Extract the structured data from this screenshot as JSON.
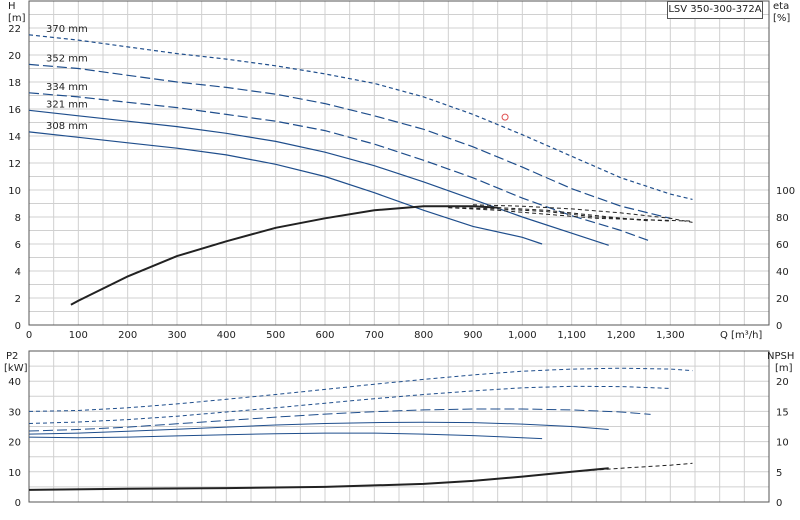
{
  "model_label": "LSV 350-300-372A",
  "colors": {
    "curve": "#1f4e8c",
    "grid": "#d0d0d0",
    "axis": "#555555",
    "marker": "#e05050"
  },
  "chart_data": [
    {
      "type": "line",
      "id": "head-efficiency",
      "xlabel": "Q [m³/h]",
      "xlim": [
        0,
        1500
      ],
      "xticks": [
        0,
        100,
        200,
        300,
        400,
        500,
        600,
        700,
        800,
        900,
        1000,
        1100,
        1200,
        1300
      ],
      "xtick_labels": [
        "0",
        "100",
        "200",
        "300",
        "400",
        "500",
        "600",
        "700",
        "800",
        "900",
        "1,000",
        "1,100",
        "1,200",
        "1,300"
      ],
      "ylabel_left": [
        "H",
        "[m]"
      ],
      "ylim_left": [
        0,
        24
      ],
      "yticks_left": [
        0,
        2,
        4,
        6,
        8,
        10,
        12,
        14,
        16,
        18,
        20,
        22
      ],
      "ylabel_right": [
        "eta",
        "[%]"
      ],
      "ylim_right": [
        0,
        240
      ],
      "yticks_right": [
        0,
        20,
        40,
        60,
        80,
        100
      ],
      "grid": true,
      "head_series": [
        {
          "name": "370 mm",
          "style": "dashed",
          "x": [
            0,
            100,
            200,
            300,
            400,
            500,
            600,
            700,
            800,
            900,
            1000,
            1100,
            1200,
            1300,
            1345
          ],
          "y": [
            21.5,
            21.1,
            20.6,
            20.1,
            19.7,
            19.2,
            18.6,
            17.9,
            16.9,
            15.6,
            14.1,
            12.5,
            10.9,
            9.7,
            9.3
          ]
        },
        {
          "name": "352 mm",
          "style": "mixed",
          "x": [
            0,
            100,
            200,
            300,
            400,
            500,
            600,
            700,
            800,
            900,
            1000,
            1100,
            1200,
            1300
          ],
          "y": [
            19.3,
            19.0,
            18.5,
            18.0,
            17.6,
            17.1,
            16.4,
            15.5,
            14.5,
            13.2,
            11.7,
            10.1,
            8.8,
            7.9
          ]
        },
        {
          "name": "334 mm",
          "style": "mixed",
          "x": [
            0,
            100,
            200,
            300,
            400,
            500,
            600,
            700,
            800,
            900,
            1000,
            1100,
            1200,
            1260
          ],
          "y": [
            17.2,
            16.9,
            16.5,
            16.1,
            15.6,
            15.1,
            14.4,
            13.4,
            12.2,
            10.9,
            9.4,
            8.1,
            7.0,
            6.2
          ]
        },
        {
          "name": "321 mm",
          "style": "solid",
          "x": [
            0,
            100,
            200,
            300,
            400,
            500,
            600,
            700,
            800,
            900,
            1000,
            1100,
            1175
          ],
          "y": [
            15.9,
            15.5,
            15.1,
            14.7,
            14.2,
            13.6,
            12.8,
            11.8,
            10.6,
            9.3,
            8.0,
            6.8,
            5.9
          ]
        },
        {
          "name": "308 mm",
          "style": "solid",
          "x": [
            0,
            100,
            200,
            300,
            400,
            500,
            600,
            700,
            800,
            900,
            1000,
            1040
          ],
          "y": [
            14.3,
            13.9,
            13.5,
            13.1,
            12.6,
            11.9,
            11.0,
            9.8,
            8.5,
            7.3,
            6.5,
            6.0
          ]
        }
      ],
      "efficiency_series": [
        {
          "style": "solid",
          "x": [
            85,
            100,
            200,
            300,
            400,
            500,
            600,
            700,
            800,
            900,
            950
          ],
          "y": [
            15,
            18,
            36,
            51,
            62,
            72,
            79,
            85,
            88,
            88,
            87
          ]
        },
        {
          "style": "dashed",
          "x": [
            900,
            1000,
            1100,
            1200,
            1300,
            1345
          ],
          "y": [
            89,
            88,
            86,
            83,
            79,
            76
          ]
        },
        {
          "style": "dashed",
          "x": [
            850,
            950,
            1050,
            1150,
            1260
          ],
          "y": [
            88,
            87,
            85,
            81,
            77
          ]
        },
        {
          "style": "dashed",
          "x": [
            850,
            950,
            1050,
            1150,
            1300
          ],
          "y": [
            87,
            86,
            84,
            80,
            77
          ]
        },
        {
          "style": "dashed",
          "x": [
            850,
            950,
            1050,
            1150,
            1345
          ],
          "y": [
            87,
            85,
            82,
            79,
            77
          ]
        }
      ],
      "duty_point": {
        "x": 965,
        "y": 15.4
      }
    },
    {
      "type": "line",
      "id": "power-npsh",
      "xlim": [
        0,
        1500
      ],
      "ylabel_left": [
        "P2",
        "[kW]"
      ],
      "ylim_left": [
        0,
        50
      ],
      "yticks_left": [
        0,
        10,
        20,
        30,
        40
      ],
      "ylabel_right": [
        "NPSH",
        "[m]"
      ],
      "ylim_right": [
        0,
        25
      ],
      "yticks_right": [
        0,
        5,
        10,
        15,
        20
      ],
      "grid": true,
      "power_series": [
        {
          "style": "dashed",
          "x": [
            0,
            100,
            200,
            300,
            400,
            500,
            600,
            700,
            800,
            900,
            1000,
            1100,
            1200,
            1300,
            1345
          ],
          "y": [
            30,
            30.3,
            31.2,
            32.5,
            34.0,
            35.6,
            37.3,
            39.0,
            40.6,
            42.1,
            43.3,
            44.0,
            44.3,
            44.0,
            43.5
          ]
        },
        {
          "style": "dashed",
          "x": [
            0,
            100,
            200,
            300,
            400,
            500,
            600,
            700,
            800,
            900,
            1000,
            1100,
            1200,
            1300
          ],
          "y": [
            26,
            26.5,
            27.3,
            28.4,
            29.8,
            31.2,
            32.7,
            34.2,
            35.6,
            36.8,
            37.8,
            38.3,
            38.2,
            37.6
          ]
        },
        {
          "style": "mixed",
          "x": [
            0,
            100,
            200,
            300,
            400,
            500,
            600,
            700,
            800,
            900,
            1000,
            1100,
            1200,
            1260
          ],
          "y": [
            23.5,
            24,
            24.8,
            25.9,
            27.0,
            28.1,
            29.1,
            29.9,
            30.5,
            30.8,
            30.8,
            30.5,
            29.8,
            29.0
          ]
        },
        {
          "style": "solid",
          "x": [
            0,
            100,
            200,
            300,
            400,
            500,
            600,
            700,
            800,
            900,
            1000,
            1100,
            1175
          ],
          "y": [
            22.5,
            22.8,
            23.4,
            24.1,
            24.8,
            25.5,
            26.0,
            26.3,
            26.4,
            26.3,
            25.8,
            25.0,
            24.0
          ]
        },
        {
          "style": "solid",
          "x": [
            0,
            100,
            200,
            300,
            400,
            500,
            600,
            700,
            800,
            900,
            1000,
            1040
          ],
          "y": [
            21.5,
            21.3,
            21.5,
            21.9,
            22.3,
            22.6,
            22.8,
            22.8,
            22.5,
            22.0,
            21.3,
            21.0
          ]
        }
      ],
      "npsh_series": [
        {
          "style": "solid",
          "x": [
            0,
            200,
            400,
            600,
            800,
            900,
            1000,
            1100,
            1175
          ],
          "y": [
            2.0,
            2.2,
            2.3,
            2.5,
            3.0,
            3.5,
            4.2,
            5.0,
            5.6
          ]
        },
        {
          "style": "dashed",
          "x": [
            1100,
            1200,
            1300,
            1345
          ],
          "y": [
            5.0,
            5.6,
            6.1,
            6.4
          ]
        }
      ]
    }
  ]
}
